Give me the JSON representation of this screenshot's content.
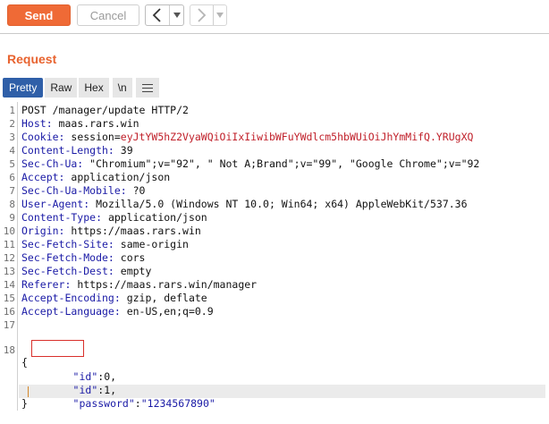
{
  "toolbar": {
    "send_label": "Send",
    "cancel_label": "Cancel"
  },
  "section_title": "Request",
  "tabs": {
    "pretty": "Pretty",
    "raw": "Raw",
    "hex": "Hex",
    "newline": "\\n"
  },
  "icons": {
    "back": "back-arrow-icon",
    "forward": "forward-arrow-icon",
    "dropdown": "chevron-down-icon",
    "menu": "hamburger-menu-icon"
  },
  "colors": {
    "accent": "#ef6a36",
    "tab_active": "#2f5fa8",
    "header_name": "#1a1aa6",
    "cookie_value": "#c0202a",
    "highlight_border": "#d9302b"
  },
  "lines": [
    {
      "n": "1",
      "name": "POST /manager/update HTTP/2",
      "value": ""
    },
    {
      "n": "2",
      "name": "Host:",
      "value": " maas.rars.win"
    },
    {
      "n": "3",
      "name": "Cookie:",
      "value": " session=",
      "cookie": "eyJtYW5hZ2VyaWQiOiIxIiwibWFuYWdlcm5hbWUiOiJhYmMifQ.YRUgXQ"
    },
    {
      "n": "4",
      "name": "Content-Length:",
      "value": " 39"
    },
    {
      "n": "5",
      "name": "Sec-Ch-Ua:",
      "value": " \"Chromium\";v=\"92\", \" Not A;Brand\";v=\"99\", \"Google Chrome\";v=\"92"
    },
    {
      "n": "6",
      "name": "Accept:",
      "value": " application/json"
    },
    {
      "n": "7",
      "name": "Sec-Ch-Ua-Mobile:",
      "value": " ?0"
    },
    {
      "n": "8",
      "name": "User-Agent:",
      "value": " Mozilla/5.0 (Windows NT 10.0; Win64; x64) AppleWebKit/537.36"
    },
    {
      "n": "9",
      "name": "Content-Type:",
      "value": " application/json"
    },
    {
      "n": "10",
      "name": "Origin:",
      "value": " https://maas.rars.win"
    },
    {
      "n": "11",
      "name": "Sec-Fetch-Site:",
      "value": " same-origin"
    },
    {
      "n": "12",
      "name": "Sec-Fetch-Mode:",
      "value": " cors"
    },
    {
      "n": "13",
      "name": "Sec-Fetch-Dest:",
      "value": " empty"
    },
    {
      "n": "14",
      "name": "Referer:",
      "value": " https://maas.rars.win/manager"
    },
    {
      "n": "15",
      "name": "Accept-Encoding:",
      "value": " gzip, deflate"
    },
    {
      "n": "16",
      "name": "Accept-Language:",
      "value": " en-US,en;q=0.9"
    },
    {
      "n": "17",
      "name": "",
      "value": ""
    }
  ],
  "body": {
    "line_number": "18",
    "open_brace": "{",
    "close_brace": "}",
    "entries": [
      {
        "key": "\"id\"",
        "sep": ":",
        "val": "0",
        "tail": ","
      },
      {
        "key": "\"id\"",
        "sep": ":",
        "val": "1",
        "tail": ","
      },
      {
        "key": "\"password\"",
        "sep": ":",
        "val": "\"1234567890\"",
        "tail": ""
      }
    ]
  }
}
